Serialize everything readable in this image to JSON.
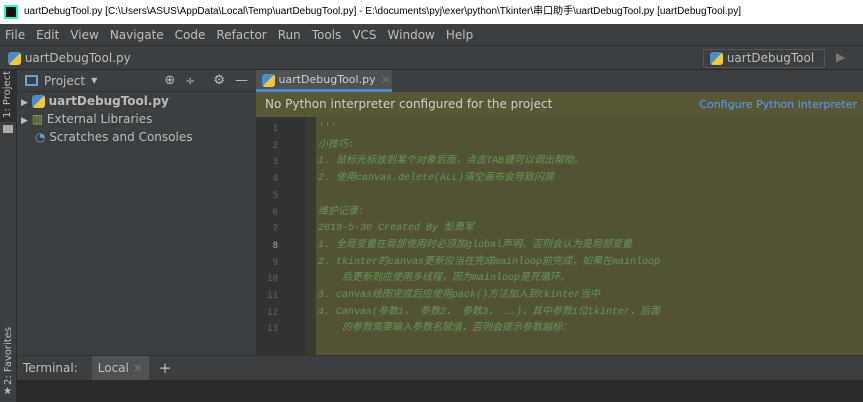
{
  "window": {
    "title": "uartDebugTool.py [C:\\Users\\ASUS\\AppData\\Local\\Temp\\uartDebugTool.py] - E:\\documents\\pyj\\exer\\python\\Tkinter\\串口助手\\uartDebugTool.py [uartDebugTool.py]",
    "app_icon": "PC"
  },
  "menu": [
    "File",
    "Edit",
    "View",
    "Navigate",
    "Code",
    "Refactor",
    "Run",
    "Tools",
    "VCS",
    "Window",
    "Help"
  ],
  "navbar": {
    "breadcrumb": "uartDebugTool.py",
    "run_config": "uartDebugTool"
  },
  "left_stripe": {
    "project": "1: Project",
    "favorites": "2: Favorites"
  },
  "project_panel": {
    "title": "Project",
    "items": [
      {
        "label": "uartDebugTool.py",
        "bold": true
      },
      {
        "label": "External Libraries"
      },
      {
        "label": "Scratches and Consoles"
      }
    ]
  },
  "editor": {
    "tab": "uartDebugTool.py",
    "notice": "No Python interpreter configured for the project",
    "notice_action": "Configure Python interpreter",
    "current_line": 8,
    "lines": [
      "'''",
      "小技巧:",
      "1. 鼠标光标放到某个对象后面，点击TAB键可以调出帮助。",
      "2. 使用canvas.delete(ALL)清空画布会导致闪屏",
      "",
      "维护记录:",
      "2019-5-30 Created By 彭勇军",
      "1. 全局变量在局部使用时必须加global声明，否则会认为是局部变量",
      "2. tkinter的canvas更新应当在完成mainloop前完成，如果在mainloop",
      "    后更新则应使用多线程，因为mainloop是死循环。",
      "3. canvas绘图完成后应使用pack()方法加入到tkinter当中",
      "4. Canvas(参数1， 参数2， 参数3， ……)，其中参数1位tkinter，后面",
      "    的参数需要输入参数名赋值，否则会提示参数越标："
    ]
  },
  "bottom": {
    "terminal_label": "Terminal:",
    "tab": "Local",
    "add": "+"
  }
}
